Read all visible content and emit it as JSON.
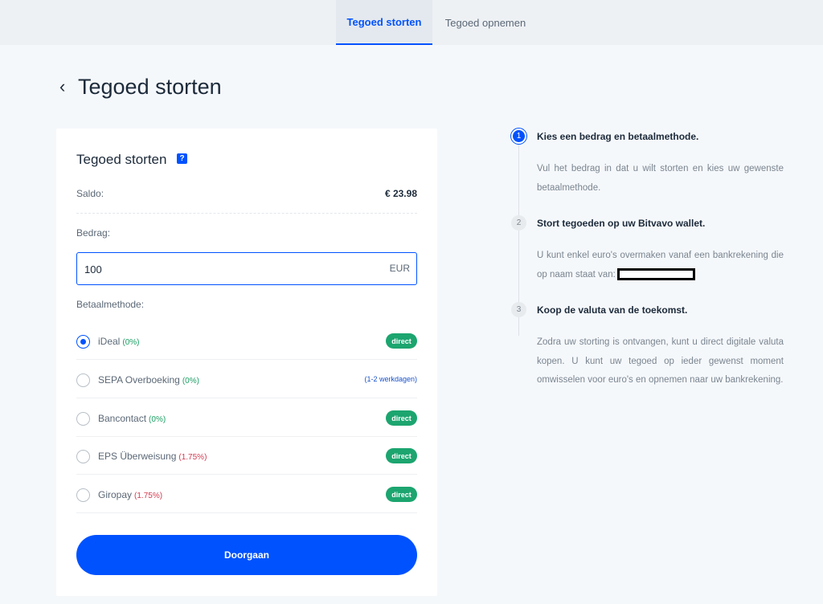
{
  "tabs": {
    "active_label": "Tegoed storten",
    "inactive_label": "Tegoed opnemen"
  },
  "page": {
    "back_symbol": "‹",
    "title": "Tegoed storten"
  },
  "card": {
    "title": "Tegoed storten",
    "help_symbol": "?",
    "saldo_label": "Saldo:",
    "saldo_value": "€ 23.98",
    "bedrag_label": "Bedrag:",
    "amount_value": "100",
    "currency": "EUR",
    "method_label": "Betaalmethode:",
    "methods": [
      {
        "name": "iDeal",
        "fee": "(0%)",
        "fee_color": "green",
        "badge": "direct",
        "selected": true
      },
      {
        "name": "SEPA Overboeking",
        "fee": "(0%)",
        "fee_color": "green",
        "badge": "(1-2 werkdagen)",
        "selected": false
      },
      {
        "name": "Bancontact",
        "fee": "(0%)",
        "fee_color": "green",
        "badge": "direct",
        "selected": false
      },
      {
        "name": "EPS Überweisung",
        "fee": "(1.75%)",
        "fee_color": "red",
        "badge": "direct",
        "selected": false
      },
      {
        "name": "Giropay",
        "fee": "(1.75%)",
        "fee_color": "red",
        "badge": "direct",
        "selected": false
      }
    ],
    "submit_label": "Doorgaan"
  },
  "steps": [
    {
      "number": "1",
      "title": "Kies een bedrag en betaalmethode.",
      "text": "Vul het bedrag in dat u wilt storten en kies uw gewenste betaalmethode."
    },
    {
      "number": "2",
      "title": "Stort tegoeden op uw Bitvavo wallet.",
      "text": "U kunt enkel euro's overmaken vanaf een bankrekening die op naam staat van:"
    },
    {
      "number": "3",
      "title": "Koop de valuta van de toekomst.",
      "text": "Zodra uw storting is ontvangen, kunt u direct digitale valuta kopen. U kunt uw tegoed op ieder gewenst moment omwisselen voor euro's en opnemen naar uw bankrekening."
    }
  ],
  "colors": {
    "accent": "#0052ff",
    "badge_green": "#1ca56f",
    "fee_green": "#1a9f62",
    "fee_red": "#d23a4f"
  }
}
